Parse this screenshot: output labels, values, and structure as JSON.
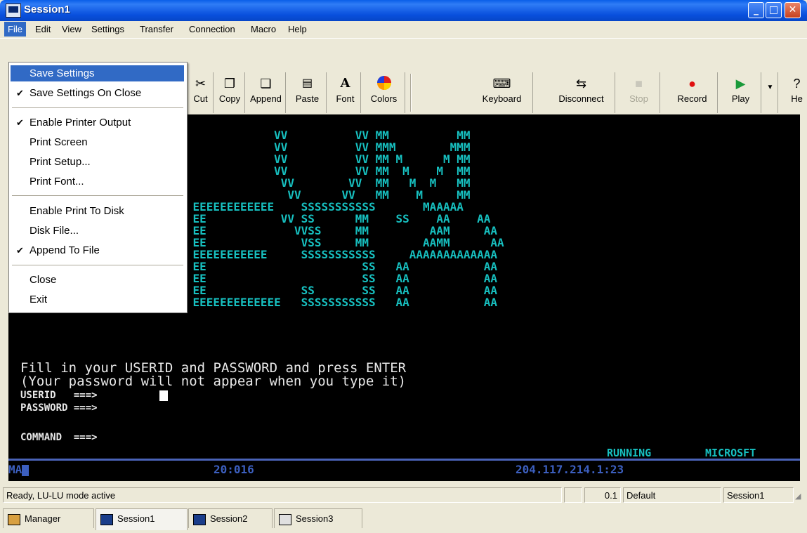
{
  "window": {
    "title": "Session1"
  },
  "menubar": {
    "items": [
      "File",
      "Edit",
      "View",
      "Settings",
      "Transfer",
      "Connection",
      "Macro",
      "Help"
    ]
  },
  "file_menu": {
    "items": [
      {
        "label": "Save Settings",
        "checked": false,
        "highlighted": true
      },
      {
        "label": "Save Settings On Close",
        "checked": true
      },
      {
        "label": "Enable Printer Output",
        "checked": true
      },
      {
        "label": "Print Screen",
        "checked": false
      },
      {
        "label": "Print Setup...",
        "checked": false
      },
      {
        "label": "Print Font...",
        "checked": false
      },
      {
        "label": "Enable Print To Disk",
        "checked": false
      },
      {
        "label": "Disk File...",
        "checked": false
      },
      {
        "label": "Append To File",
        "checked": true
      },
      {
        "label": "Close",
        "checked": false
      },
      {
        "label": "Exit",
        "checked": false
      }
    ],
    "checkmark": "✔"
  },
  "toolbar": {
    "buttons": [
      {
        "label": "Cut",
        "icon": "scissors-icon",
        "glyph": "✂"
      },
      {
        "label": "Copy",
        "icon": "copy-icon",
        "glyph": "❐"
      },
      {
        "label": "Append",
        "icon": "append-icon",
        "glyph": "❏"
      },
      {
        "label": "Paste",
        "icon": "paste-icon",
        "glyph": "📋"
      },
      {
        "label": "Font",
        "icon": "font-icon",
        "glyph": "A"
      },
      {
        "label": "Colors",
        "icon": "colors-icon",
        "glyph": "●"
      },
      {
        "label": "Keyboard",
        "icon": "keyboard-icon",
        "glyph": "⌨"
      },
      {
        "label": "Disconnect",
        "icon": "disconnect-icon",
        "glyph": "⇆"
      },
      {
        "label": "Stop",
        "icon": "stop-icon",
        "glyph": "■"
      },
      {
        "label": "Record",
        "icon": "record-icon",
        "glyph": "●"
      },
      {
        "label": "Play",
        "icon": "play-icon",
        "glyph": "▶"
      },
      {
        "label": "He",
        "icon": "help-icon",
        "glyph": "?"
      }
    ]
  },
  "terminal": {
    "banner": [
      "                VV          VV MM          MM",
      "                VV          VV MMM        MMM",
      "                VV          VV MM M      M MM",
      "                VV          VV MM  M    M  MM",
      "                 VV        VV  MM   M  M   MM",
      "                  VV      VV   MM    M     MM",
      "    EEEEEEEEEEEE    SSSSSSSSSSS       MAAAAA",
      "    EE           VV SS      MM    SS    AA    AA",
      "    EE             VVSS     MM         AAM     AA",
      "    EE              VSS     MM        AAMM      AA",
      "    EEEEEEEEEEE     SSSSSSSSSSS     AAAAAAAAAAAAA",
      "    EE                       SS   AA           AA",
      "    EE                       SS   AA           AA",
      "    EE              SS       SS   AA           AA",
      "    EEEEEEEEEEEEE   SSSSSSSSSSS   AA           AA"
    ],
    "prompt_line1": "Fill in your USERID and PASSWORD and press ENTER",
    "prompt_line2": "(Your password will not appear when you type it)",
    "userid_label": "USERID   ===>",
    "password_label": "PASSWORD ===>",
    "command_label": "COMMAND  ===>",
    "running": "RUNNING",
    "system": "MICROSFT",
    "oia_left": "MA",
    "oia_cursor_pos": "20:016",
    "oia_host": "204.117.214.1:23"
  },
  "statusbar": {
    "message": "Ready, LU-LU mode active",
    "field1": "",
    "field2": "0.1",
    "field3": "Default",
    "field4": "Session1"
  },
  "tabs": [
    {
      "label": "Manager",
      "icon": "manager-icon",
      "active": false
    },
    {
      "label": "Session1",
      "icon": "terminal-icon",
      "active": true
    },
    {
      "label": "Session2",
      "icon": "terminal-icon",
      "active": false
    },
    {
      "label": "Session3",
      "icon": "printer-icon",
      "active": false
    }
  ],
  "colors": {
    "terminal_text": "#17c0c0",
    "menu_highlight": "#316ac5",
    "oia_text": "#3c5fbf"
  }
}
